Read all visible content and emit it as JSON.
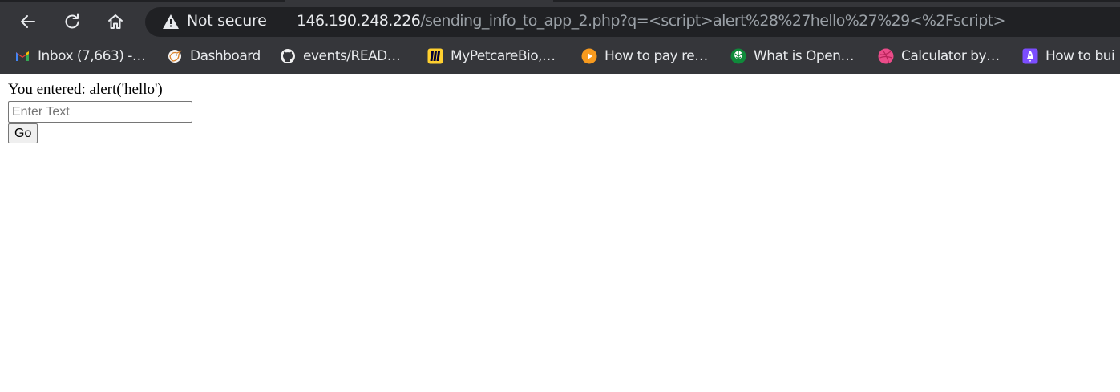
{
  "browser": {
    "security_label": "Not secure",
    "url_host": "146.190.248.226",
    "url_path": "/sending_info_to_app_2.php?q=<script>alert%28%27hello%27%29<%2Fscript>",
    "icons": {
      "back": "back-arrow-icon",
      "reload": "reload-icon",
      "home": "home-icon",
      "security": "warning-triangle-icon"
    },
    "colors": {
      "frame": "#35363a",
      "omnibox": "#202124",
      "text": "#e8eaed",
      "muted": "#9aa0a6"
    }
  },
  "bookmarks": [
    {
      "label": "Inbox (7,663) -…",
      "icon": "gmail-icon"
    },
    {
      "label": "Dashboard",
      "icon": "bird-icon"
    },
    {
      "label": "events/READ…",
      "icon": "github-icon"
    },
    {
      "label": "MyPetcareBio,…",
      "icon": "miro-icon"
    },
    {
      "label": "How to pay re…",
      "icon": "play-circle-icon"
    },
    {
      "label": "What is Open…",
      "icon": "tree-icon"
    },
    {
      "label": "Calculator by…",
      "icon": "dribbble-icon"
    },
    {
      "label": "How to bui",
      "icon": "rocket-icon"
    }
  ],
  "page": {
    "entered_text": "You entered: alert('hello')",
    "input_placeholder": "Enter Text",
    "input_value": "",
    "go_label": "Go"
  }
}
